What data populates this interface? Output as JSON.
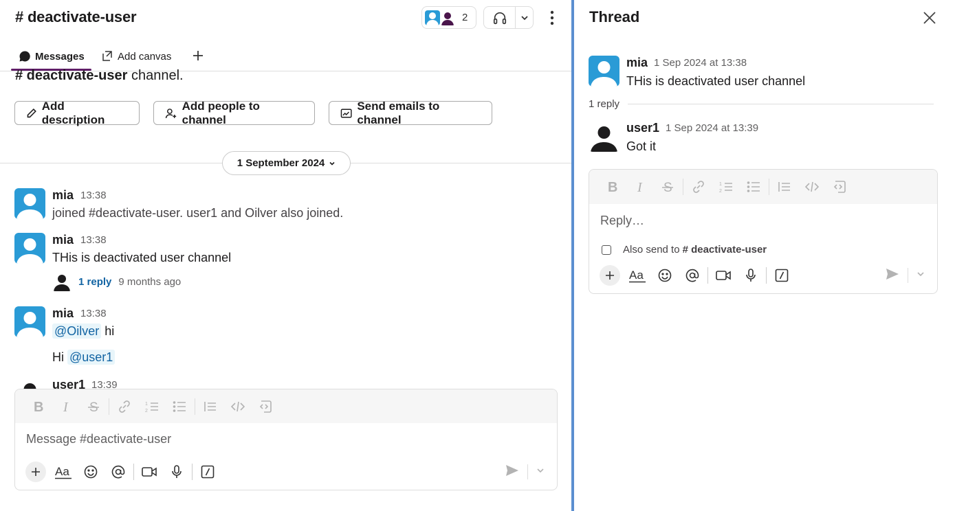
{
  "channel": {
    "title": "# deactivate-user",
    "member_count": "2"
  },
  "tabs": [
    {
      "label": "Messages"
    },
    {
      "label": "Add canvas"
    }
  ],
  "intro": {
    "channel_name": "# deactivate-user",
    "suffix": " channel."
  },
  "actions": {
    "add_description": "Add description",
    "add_people": "Add people to channel",
    "send_emails": "Send emails to channel"
  },
  "date_divider": "1 September 2024",
  "messages": [
    {
      "author": "mia",
      "time": "13:38",
      "text": "joined #deactivate-user. user1 and Oilver also joined."
    },
    {
      "author": "mia",
      "time": "13:38",
      "text": "THis is deactivated user channel",
      "reply_count": "1 reply",
      "reply_ago": "9 months ago"
    },
    {
      "author": "mia",
      "time": "13:38",
      "mention1": "@Oilver",
      "text1": " hi",
      "text2_prefix": "Hi ",
      "mention2": "@user1"
    },
    {
      "author": "user1",
      "time": "13:39"
    }
  ],
  "composer": {
    "placeholder": "Message #deactivate-user"
  },
  "thread": {
    "title": "Thread",
    "parent": {
      "author": "mia",
      "time": "1 Sep 2024 at 13:38",
      "text": "THis is deactivated user channel"
    },
    "replies_label": "1 reply",
    "reply": {
      "author": "user1",
      "time": "1 Sep 2024 at 13:39",
      "text": "Got it"
    },
    "composer_placeholder": "Reply…",
    "also_send_label": "Also send to",
    "also_send_channel": "# deactivate-user"
  },
  "colors": {
    "accent_purple": "#611f69",
    "link_blue": "#1264a3",
    "avatar_blue": "#2a9bd6",
    "pane_divider": "#5b8fd0"
  }
}
